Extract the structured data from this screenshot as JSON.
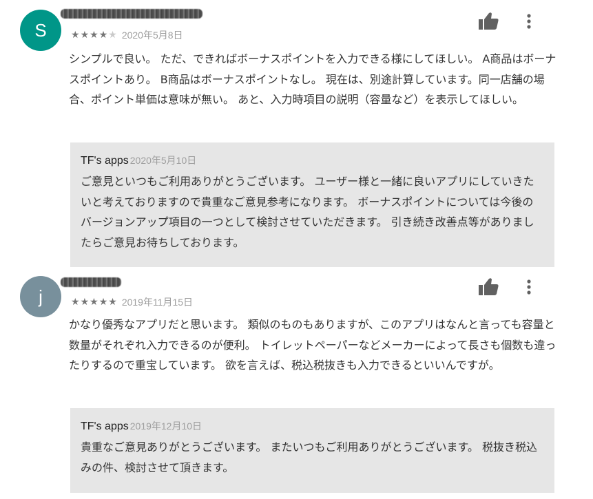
{
  "reviews": [
    {
      "avatar_letter": "S",
      "avatar_color": "#009688",
      "stars_filled": 4,
      "stars_total": 5,
      "rating_text": "★★★★☆",
      "date": "2020年5月8日",
      "text": "シンプルで良い。 ただ、できればボーナスポイントを入力できる様にしてほしい。 A商品はボーナスポイントあり。 B商品はボーナスポイントなし。 現在は、別途計算しています。同一店舗の場合、ポイント単価は意味が無い。 あと、入力時項目の説明（容量など）を表示してほしい。",
      "reply": {
        "developer": "TF's apps",
        "date": "2020年5月10日",
        "text": "ご意見といつもご利用ありがとうございます。 ユーザー様と一緒に良いアプリにしていきたいと考えておりますので貴重なご意見参考になります。 ボーナスポイントについては今後のバージョンアップ項目の一つとして検討させていただきます。 引き続き改善点等がありましたらご意見お待ちしております。"
      }
    },
    {
      "avatar_letter": "j",
      "avatar_color": "#78909c",
      "stars_filled": 5,
      "stars_total": 5,
      "rating_text": "★★★★★",
      "date": "2019年11月15日",
      "text": "かなり優秀なアプリだと思います。 類似のものもありますが、このアプリはなんと言っても容量と数量がそれぞれ入力できるのが便利。 トイレットペーパーなどメーカーによって長さも個数も違ったりするので重宝しています。 欲を言えば、税込税抜きも入力できるといいんですが。",
      "reply": {
        "developer": "TF's apps",
        "date": "2019年12月10日",
        "text": "貴重なご意見ありがとうございます。 またいつもご利用ありがとうございます。 税抜き税込みの件、検討させて頂きます。"
      }
    }
  ],
  "icons": {
    "like": "thumbs-up-icon",
    "more": "more-vert-icon"
  }
}
